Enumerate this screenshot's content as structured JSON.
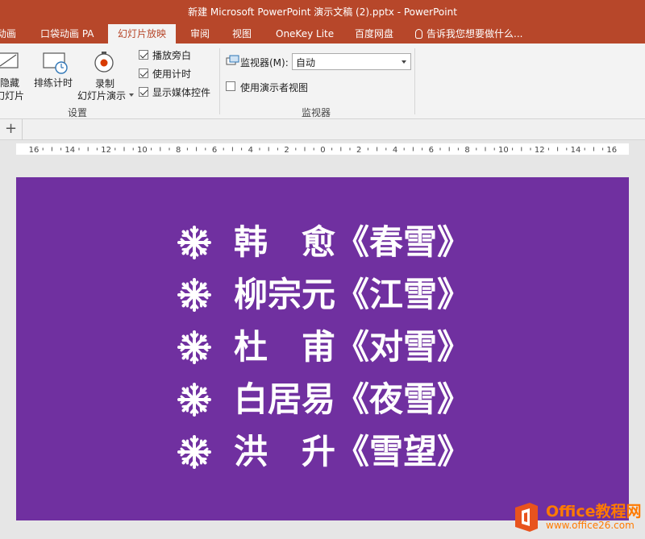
{
  "window": {
    "title": "新建 Microsoft PowerPoint 演示文稿 (2).pptx - PowerPoint"
  },
  "tabs": [
    {
      "label": "动画",
      "active": false
    },
    {
      "label": "口袋动画 PA",
      "active": false
    },
    {
      "label": "幻灯片放映",
      "active": true
    },
    {
      "label": "审阅",
      "active": false
    },
    {
      "label": "视图",
      "active": false
    },
    {
      "label": "OneKey Lite",
      "active": false
    },
    {
      "label": "百度网盘",
      "active": false
    }
  ],
  "tell_me": "告诉我您想要做什么...",
  "ribbon": {
    "setup": {
      "hide_slide_label_1": "隐藏",
      "hide_slide_label_2": "幻灯片",
      "rehearse_label": "排练计时",
      "record_label_1": "录制",
      "record_label_2": "幻灯片演示",
      "play_narrations": "播放旁白",
      "use_timings": "使用计时",
      "show_media_controls": "显示媒体控件",
      "group_label": "设置"
    },
    "monitors": {
      "monitor_label": "监视器(M):",
      "monitor_value": "自动",
      "presenter_view": "使用演示者视图",
      "group_label": "监视器"
    }
  },
  "add_slide_symbol": "+",
  "ruler_labels": [
    "16",
    "14",
    "12",
    "10",
    "8",
    "6",
    "4",
    "2",
    "0",
    "2",
    "4",
    "6",
    "8",
    "10",
    "12",
    "14",
    "16"
  ],
  "slide": {
    "background": "#7030a0",
    "lines": [
      {
        "text": "韩　愈《春雪》"
      },
      {
        "text": "柳宗元《江雪》"
      },
      {
        "text": "杜　甫《对雪》"
      },
      {
        "text": "白居易《夜雪》"
      },
      {
        "text": "洪　升《雪望》"
      }
    ]
  },
  "watermark": {
    "name": "Office教程网",
    "url": "www.office26.com"
  },
  "colors": {
    "accent": "#b7472a",
    "ribbon_bg": "#f3f3f3",
    "watermark": "#ff7a00"
  }
}
